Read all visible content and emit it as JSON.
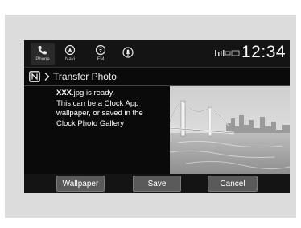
{
  "topbar": {
    "apps": [
      {
        "label": "Phone",
        "icon": "phone-icon"
      },
      {
        "label": "Navi",
        "icon": "navigation-icon"
      },
      {
        "label": "FM",
        "icon": "radio-icon"
      },
      {
        "label": "",
        "icon": "voice-icon"
      }
    ],
    "time": "12:34"
  },
  "header": {
    "title": "Transfer Photo",
    "icon": "nfc-icon"
  },
  "message": {
    "filename": "XXX",
    "line1_rest": ".jpg is ready.",
    "line2": "This can be a Clock App",
    "line3": "wallpaper, or saved in the",
    "line4": "Clock Photo Gallery"
  },
  "buttons": {
    "wallpaper": "Wallpaper",
    "save": "Save",
    "cancel": "Cancel"
  },
  "colors": {
    "screen_bg": "#0a0a0a",
    "button_bg": "#5a5a5a",
    "text": "#ffffff"
  }
}
